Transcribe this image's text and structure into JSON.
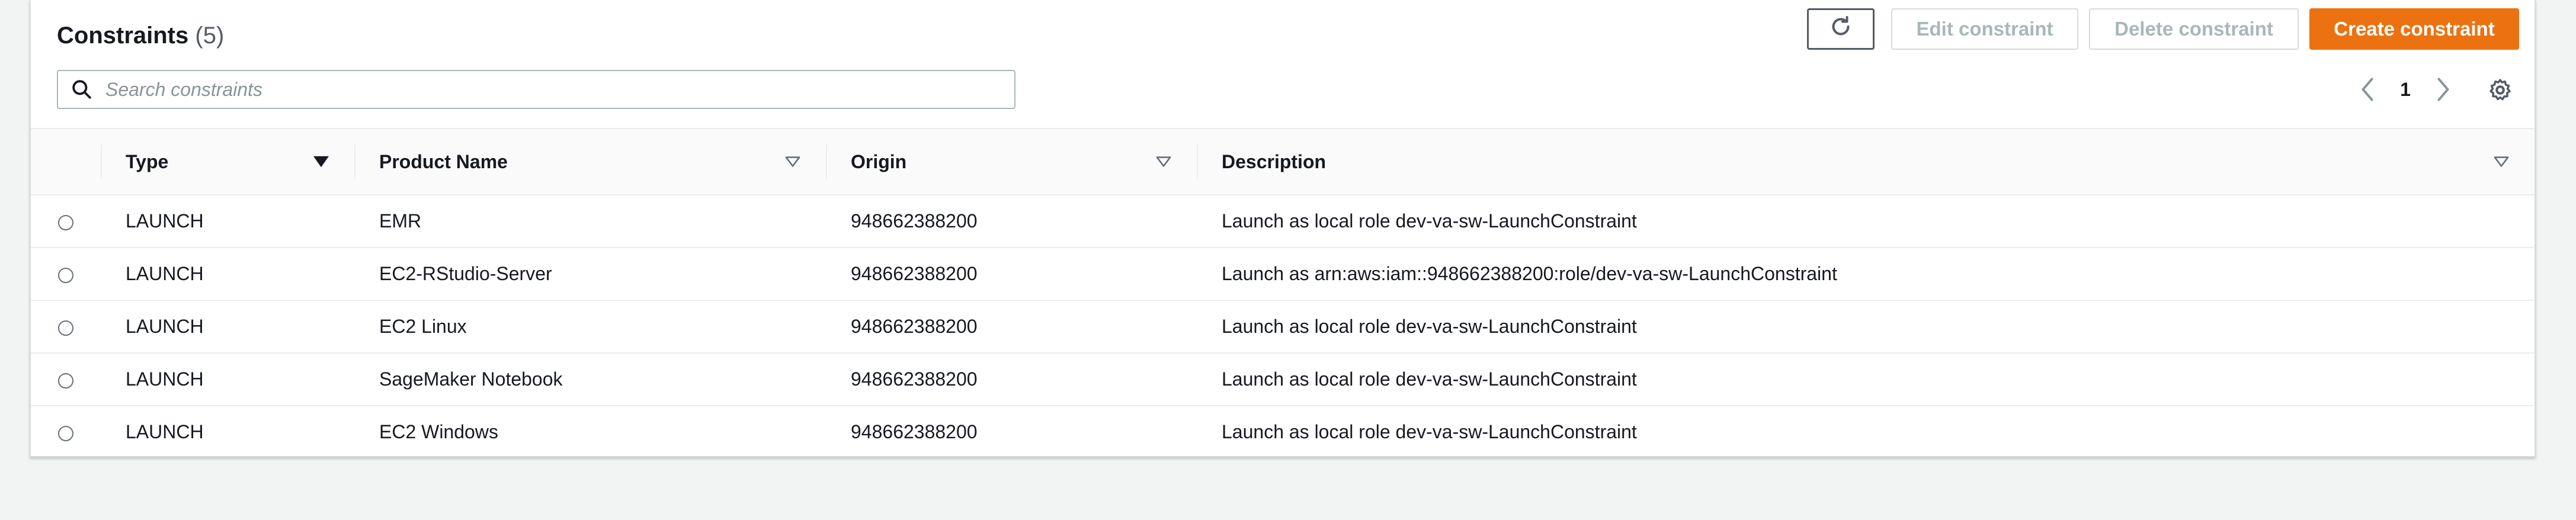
{
  "header": {
    "title": "Constraints",
    "count": "(5)"
  },
  "toolbar": {
    "refresh_icon": "refresh-icon",
    "edit_label": "Edit constraint",
    "delete_label": "Delete constraint",
    "create_label": "Create constraint"
  },
  "search": {
    "placeholder": "Search constraints",
    "value": ""
  },
  "pagination": {
    "current_page": "1"
  },
  "table": {
    "columns": {
      "type": "Type",
      "product_name": "Product Name",
      "origin": "Origin",
      "description": "Description"
    },
    "rows": [
      {
        "type": "LAUNCH",
        "product_name": "EMR",
        "origin": "948662388200",
        "description": "Launch as local role dev-va-sw-LaunchConstraint"
      },
      {
        "type": "LAUNCH",
        "product_name": "EC2-RStudio-Server",
        "origin": "948662388200",
        "description": "Launch as arn:aws:iam::948662388200:role/dev-va-sw-LaunchConstraint"
      },
      {
        "type": "LAUNCH",
        "product_name": "EC2 Linux",
        "origin": "948662388200",
        "description": "Launch as local role dev-va-sw-LaunchConstraint"
      },
      {
        "type": "LAUNCH",
        "product_name": "SageMaker Notebook",
        "origin": "948662388200",
        "description": "Launch as local role dev-va-sw-LaunchConstraint"
      },
      {
        "type": "LAUNCH",
        "product_name": "EC2 Windows",
        "origin": "948662388200",
        "description": "Launch as local role dev-va-sw-LaunchConstraint"
      }
    ]
  },
  "colors": {
    "accent": "#ec7211",
    "border": "#d5dbdb",
    "background": "#f2f3f3",
    "text": "#16191f",
    "disabled_text": "#aab7b8"
  }
}
